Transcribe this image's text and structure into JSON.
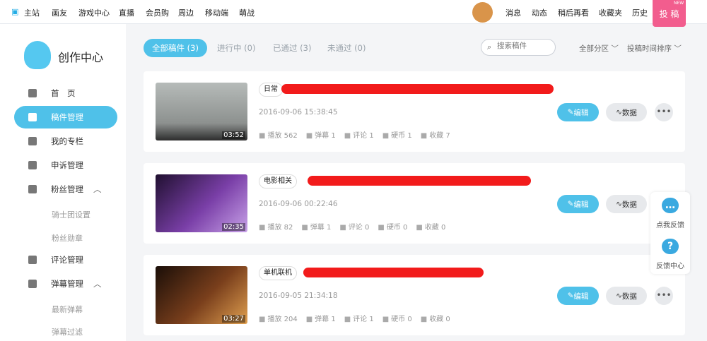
{
  "topnav": {
    "home": "主站",
    "items": [
      "画友",
      "游戏中心",
      "直播",
      "会员购",
      "周边",
      "移动端",
      "萌战"
    ],
    "right": [
      "消息",
      "动态",
      "稍后再看",
      "收藏夹",
      "历史"
    ],
    "upload": "投 稿",
    "new_badge": "NEW"
  },
  "sidebar": {
    "title": "创作中心",
    "menu": [
      "首　页",
      "稿件管理",
      "我的专栏",
      "申诉管理",
      "粉丝管理",
      "骑士团设置",
      "粉丝勋章",
      "评论管理",
      "弹幕管理",
      "最新弹幕",
      "弹幕过滤"
    ]
  },
  "tabs": [
    "全部稿件 (3)",
    "进行中 (0)",
    "已通过 (3)",
    "未通过 (0)"
  ],
  "search": {
    "placeholder": "搜索稿件"
  },
  "filters": {
    "zone": "全部分区",
    "sort": "投稿时间排序"
  },
  "posts": [
    {
      "category": "日常",
      "duration": "03:52",
      "date": "2016-09-06 15:38:45",
      "stats": [
        "播放 562",
        "弹幕 1",
        "评论 1",
        "硬币 1",
        "收藏 7"
      ]
    },
    {
      "category": "电影相关",
      "duration": "02:35",
      "date": "2016-09-06 00:22:46",
      "stats": [
        "播放 82",
        "弹幕 1",
        "评论 0",
        "硬币 0",
        "收藏 0"
      ]
    },
    {
      "category": "单机联机",
      "duration": "03:27",
      "date": "2016-09-05 21:34:18",
      "stats": [
        "播放 204",
        "弹幕 1",
        "评论 1",
        "硬币 0",
        "收藏 0"
      ]
    }
  ],
  "actions": {
    "edit": "编辑",
    "data": "数据",
    "more": "•••"
  },
  "feedback": {
    "a": "点我反馈",
    "b": "反馈中心"
  }
}
